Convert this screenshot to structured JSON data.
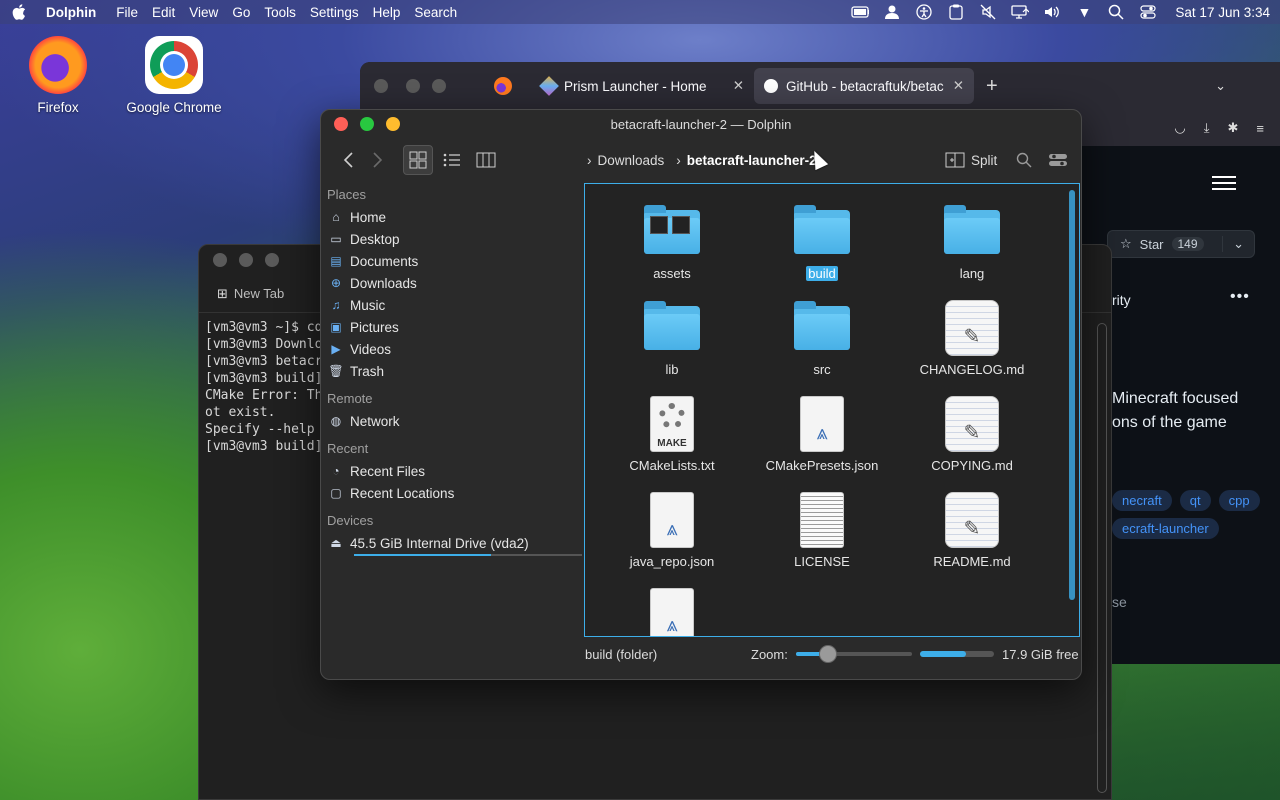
{
  "menubar": {
    "app_name": "Dolphin",
    "menus": [
      "File",
      "Edit",
      "View",
      "Go",
      "Tools",
      "Settings",
      "Help",
      "Search"
    ],
    "tray_icons": [
      "battery-icon",
      "user-icon",
      "accessibility-icon",
      "clipboard-icon",
      "mute-icon",
      "display-icon",
      "volume-icon",
      "dropdown-icon",
      "search-icon",
      "control-center-icon"
    ],
    "clock": "Sat 17 Jun 3:34"
  },
  "desktop": {
    "icons": [
      {
        "label": "Firefox",
        "icon": "firefox-icon"
      },
      {
        "label": "Google Chrome",
        "icon": "chrome-icon"
      }
    ]
  },
  "browser": {
    "tabs": [
      {
        "label": "Prism Launcher - Home",
        "icon": "prism-icon",
        "active": false
      },
      {
        "label": "GitHub - betacraftuk/betac",
        "icon": "github-icon",
        "active": true
      }
    ],
    "new_tab": "+",
    "page": {
      "star_label": "Star",
      "star_count": "149",
      "tab_partial": "rity",
      "desc_line1": "Minecraft focused",
      "desc_line2": "ons of the game",
      "topics": [
        "necraft",
        "qt",
        "cpp",
        "ecraft-launcher"
      ],
      "license_partial": "se"
    }
  },
  "terminal": {
    "new_tab_label": "New Tab",
    "lines": [
      "[vm3@vm3 ~]$ cd",
      "[vm3@vm3 Downlo",
      "[vm3@vm3 betacr",
      "[vm3@vm3 build]",
      "CMake Error: Th",
      "ot exist.",
      "Specify --help",
      "[vm3@vm3 build]"
    ]
  },
  "dolphin": {
    "title": "betacraft-launcher-2 — Dolphin",
    "breadcrumb": {
      "parent": "Downloads",
      "current": "betacraft-launcher-2"
    },
    "split_label": "Split",
    "places": {
      "header": "Places",
      "items": [
        {
          "label": "Home",
          "icon": "home-icon"
        },
        {
          "label": "Desktop",
          "icon": "desktop-icon"
        },
        {
          "label": "Documents",
          "icon": "documents-icon"
        },
        {
          "label": "Downloads",
          "icon": "downloads-icon"
        },
        {
          "label": "Music",
          "icon": "music-icon"
        },
        {
          "label": "Pictures",
          "icon": "pictures-icon"
        },
        {
          "label": "Videos",
          "icon": "videos-icon"
        },
        {
          "label": "Trash",
          "icon": "trash-icon"
        }
      ]
    },
    "remote": {
      "header": "Remote",
      "items": [
        {
          "label": "Network",
          "icon": "network-icon"
        }
      ]
    },
    "recent": {
      "header": "Recent",
      "items": [
        {
          "label": "Recent Files",
          "icon": "recent-files-icon"
        },
        {
          "label": "Recent Locations",
          "icon": "recent-locations-icon"
        }
      ]
    },
    "devices": {
      "header": "Devices",
      "items": [
        {
          "label": "45.5 GiB Internal Drive (vda2)",
          "icon": "drive-icon",
          "usage": 0.6
        }
      ]
    },
    "files": [
      {
        "name": "assets",
        "type": "folder-thumbs",
        "selected": false
      },
      {
        "name": "build",
        "type": "folder",
        "selected": true
      },
      {
        "name": "lang",
        "type": "folder",
        "selected": false
      },
      {
        "name": "lib",
        "type": "folder",
        "selected": false
      },
      {
        "name": "src",
        "type": "folder",
        "selected": false
      },
      {
        "name": "CHANGELOG.md",
        "type": "markdown",
        "selected": false
      },
      {
        "name": "CMakeLists.txt",
        "type": "cmake",
        "selected": false
      },
      {
        "name": "CMakePresets.json",
        "type": "json",
        "selected": false
      },
      {
        "name": "COPYING.md",
        "type": "markdown",
        "selected": false
      },
      {
        "name": "java_repo.json",
        "type": "json",
        "selected": false
      },
      {
        "name": "LICENSE",
        "type": "text",
        "selected": false
      },
      {
        "name": "README.md",
        "type": "markdown",
        "selected": false
      },
      {
        "name": "",
        "type": "json",
        "selected": false
      }
    ],
    "status": {
      "selection": "build (folder)",
      "zoom_label": "Zoom:",
      "zoom_level": 0.28,
      "free_label": "17.9 GiB free",
      "free_fraction": 0.62
    },
    "accent": "#3daee9"
  }
}
